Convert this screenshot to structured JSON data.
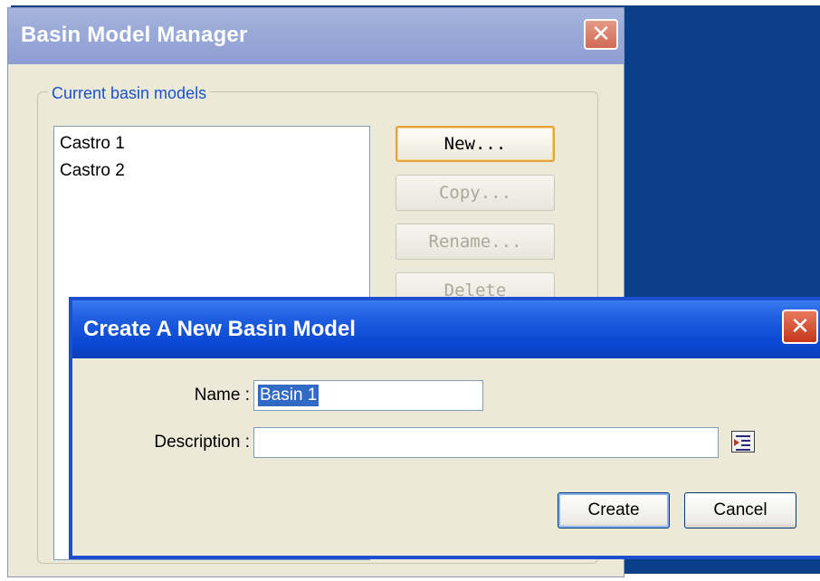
{
  "manager": {
    "title": "Basin Model Manager",
    "group_label": "Current basin models",
    "models": [
      "Castro 1",
      "Castro 2"
    ],
    "buttons": {
      "new": "New...",
      "copy": "Copy...",
      "rename": "Rename...",
      "delete": "Delete"
    }
  },
  "dialog": {
    "title": "Create A New Basin Model",
    "name_label": "Name :",
    "name_value": "Basin 1",
    "description_label": "Description :",
    "description_value": "",
    "create_label": "Create",
    "cancel_label": "Cancel"
  },
  "icons": {
    "close": "close-icon",
    "description_browse": "browse-description-icon"
  },
  "colors": {
    "desktop": "#0a3f8a",
    "active_title": "#0a47d2",
    "inactive_title": "#9aaad8",
    "window_bg": "#ece9d8",
    "group_label": "#1a52c9",
    "selection": "#316ac5"
  }
}
